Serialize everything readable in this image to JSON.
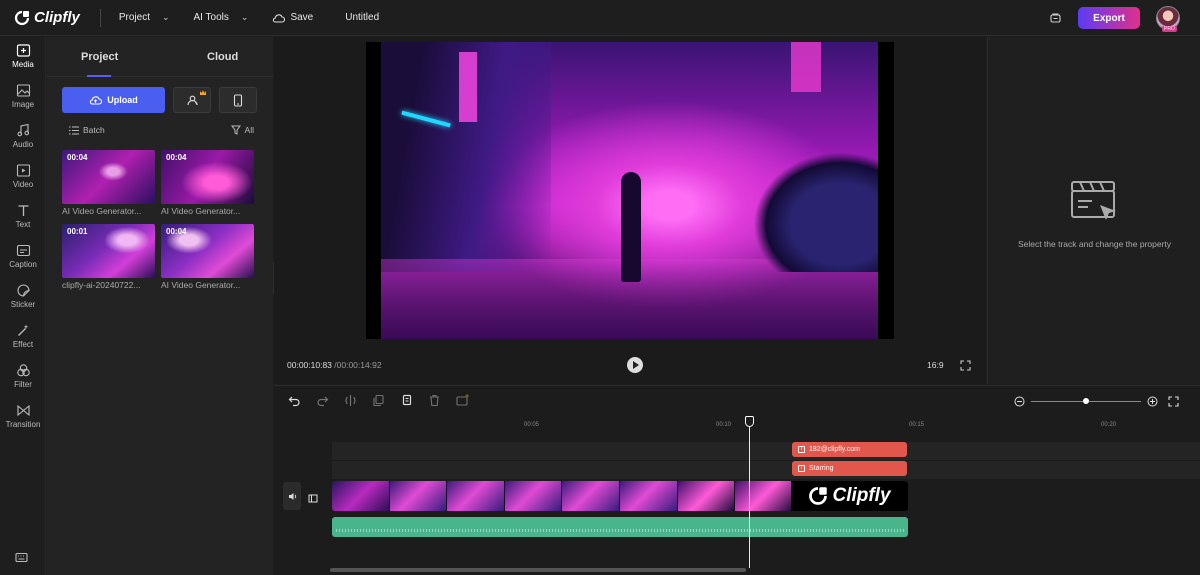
{
  "header": {
    "logo_text": "Clipfly",
    "menu_project": "Project",
    "menu_ai_tools": "AI Tools",
    "save_label": "Save",
    "doc_title": "Untitled",
    "export_label": "Export",
    "avatar_badge": "PRO"
  },
  "rail": {
    "items": [
      {
        "label": "Media",
        "icon": "media-icon"
      },
      {
        "label": "Image",
        "icon": "image-icon"
      },
      {
        "label": "Audio",
        "icon": "audio-icon"
      },
      {
        "label": "Video",
        "icon": "video-icon"
      },
      {
        "label": "Text",
        "icon": "text-icon"
      },
      {
        "label": "Caption",
        "icon": "caption-icon"
      },
      {
        "label": "Sticker",
        "icon": "sticker-icon"
      },
      {
        "label": "Effect",
        "icon": "effect-icon"
      },
      {
        "label": "Filter",
        "icon": "filter-icon"
      },
      {
        "label": "Transition",
        "icon": "transition-icon"
      }
    ]
  },
  "media": {
    "tab_project": "Project",
    "tab_cloud": "Cloud",
    "upload_label": "Upload",
    "batch_label": "Batch",
    "filter_label": "All",
    "items": [
      {
        "duration": "00:04",
        "name": "AI Video Generator..."
      },
      {
        "duration": "00:04",
        "name": "AI Video Generator..."
      },
      {
        "duration": "00:01",
        "name": "clipfly-ai-20240722..."
      },
      {
        "duration": "00:04",
        "name": "AI Video Generator..."
      }
    ]
  },
  "preview": {
    "current_time": "00:00:10:83",
    "total_time": "/00:00:14:92",
    "aspect_ratio": "16:9"
  },
  "properties": {
    "hint": "Select the track and change the property"
  },
  "timeline": {
    "ruler_labels": [
      "00:05",
      "00:10",
      "00:15",
      "00:20"
    ],
    "text_clips": [
      "182@clipfly.com",
      "Starring"
    ],
    "end_clip_text": "Clipfly",
    "zoom_level": 0.5
  },
  "colors": {
    "accent": "#4a5ff0",
    "export_gradient_start": "#5b3cf5",
    "export_gradient_end": "#e0308a",
    "text_clip": "#e2574c",
    "audio_track": "#4ab58c"
  }
}
